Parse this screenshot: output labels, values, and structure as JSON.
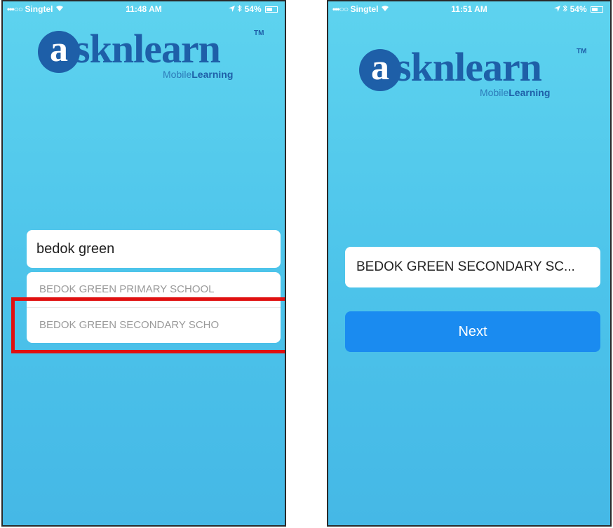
{
  "left_screen": {
    "status": {
      "dots": "•••○○",
      "carrier": "Singtel",
      "wifi_icon": "wifi-icon",
      "time": "11:48 AM",
      "location_icon": "location-arrow-icon",
      "bluetooth_icon": "bluetooth-icon",
      "battery": "54%"
    },
    "logo": {
      "letter": "a",
      "word": "sknlearn",
      "tm": "TM",
      "sub_light": "Mobile",
      "sub_bold": "Learning"
    },
    "search": {
      "value": "bedok green"
    },
    "suggestions": [
      "BEDOK GREEN PRIMARY SCHOOL",
      "BEDOK GREEN SECONDARY SCHO"
    ],
    "highlight_color": "#e01010"
  },
  "right_screen": {
    "status": {
      "dots": "•••○○",
      "carrier": "Singtel",
      "wifi_icon": "wifi-icon",
      "time": "11:51 AM",
      "location_icon": "location-arrow-icon",
      "bluetooth_icon": "bluetooth-icon",
      "battery": "54%"
    },
    "logo": {
      "letter": "a",
      "word": "sknlearn",
      "tm": "TM",
      "sub_light": "Mobile",
      "sub_bold": "Learning"
    },
    "selected_school": "BEDOK GREEN SECONDARY SC...",
    "next_label": "Next"
  },
  "colors": {
    "background_top": "#5ed3ef",
    "background_bottom": "#45b8e6",
    "brand": "#1e5fa8",
    "button": "#1a8bf0"
  }
}
